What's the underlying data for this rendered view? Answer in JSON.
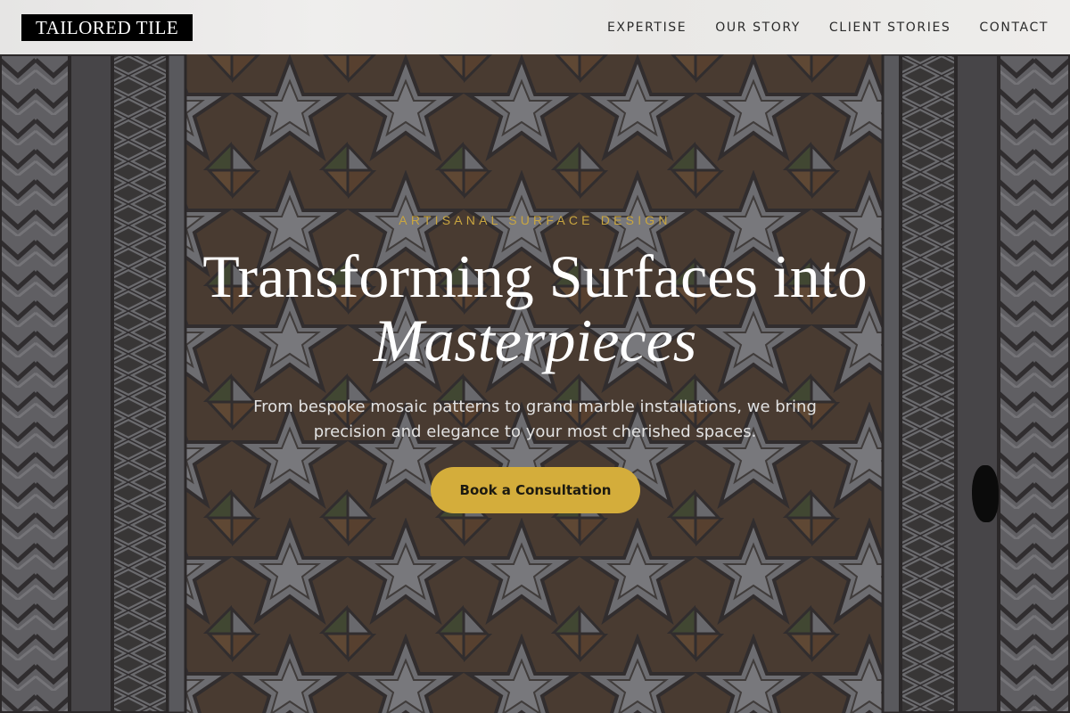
{
  "header": {
    "logo": "TAILORED TILE",
    "nav": [
      "EXPERTISE",
      "OUR STORY",
      "CLIENT STORIES",
      "CONTACT"
    ]
  },
  "hero": {
    "eyebrow": "ARTISANAL SURFACE DESIGN",
    "headline_line1": "Transforming Surfaces into",
    "headline_line2": "Masterpieces",
    "subheadline": "From bespoke mosaic patterns to grand marble installations, we bring precision and elegance to your most cherished spaces.",
    "cta_label": "Book a Consultation"
  },
  "colors": {
    "accent_gold": "#d4ad3b",
    "eyebrow_gold": "#c9a640",
    "logo_bg": "#000000",
    "header_bg": "#ecebea"
  }
}
